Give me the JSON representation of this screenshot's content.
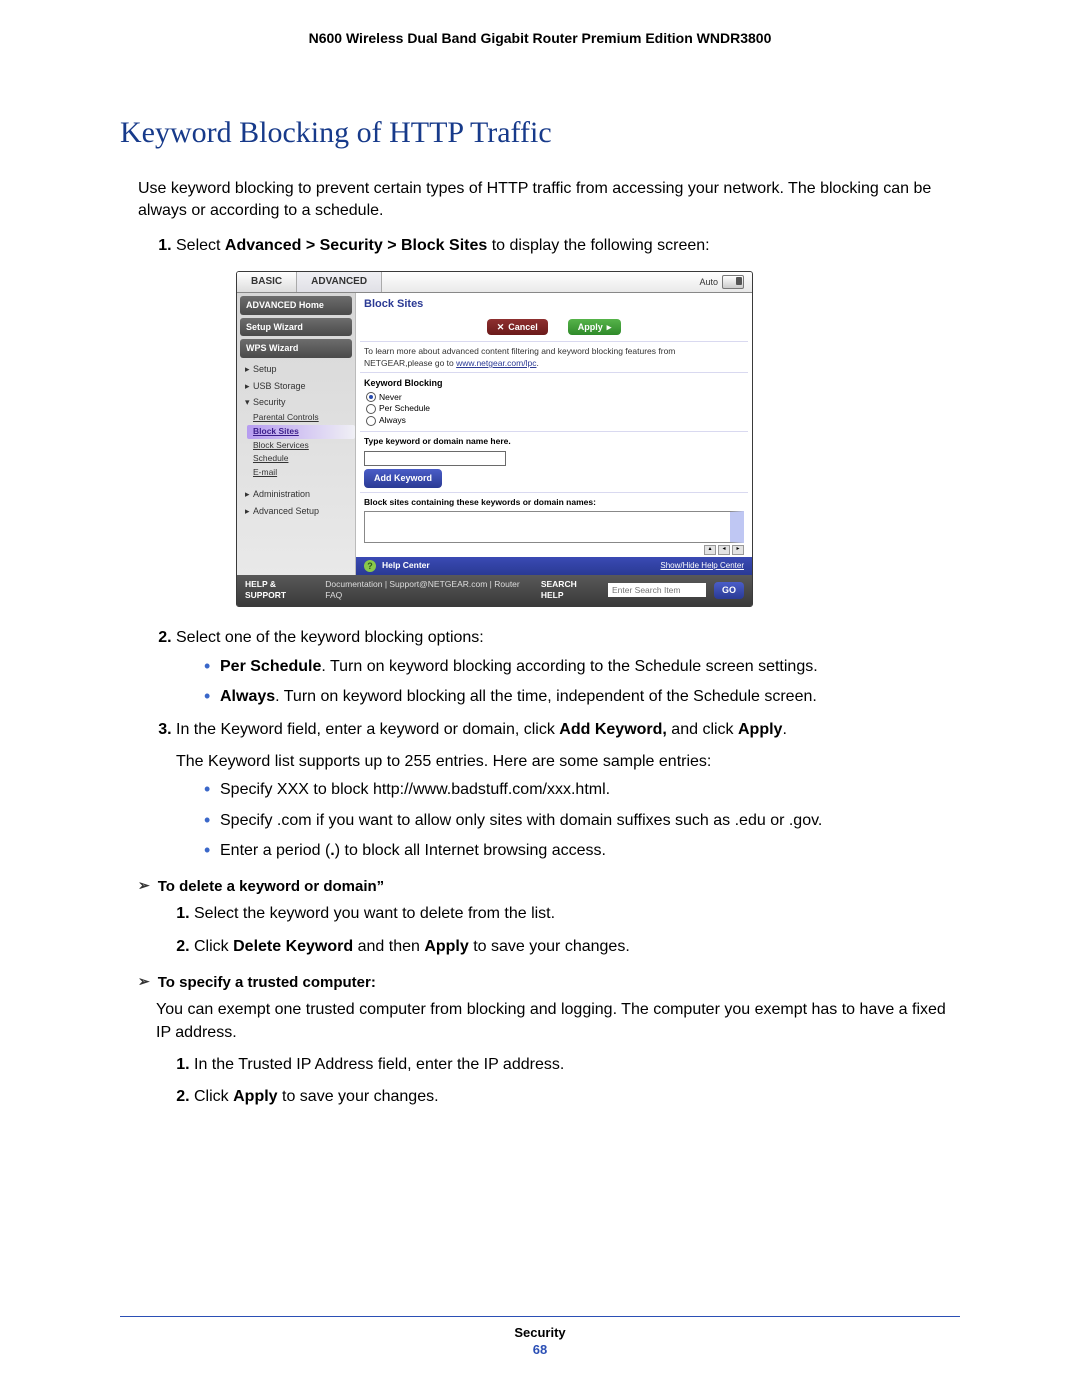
{
  "doc_header": "N600 Wireless Dual Band Gigabit Router Premium Edition WNDR3800",
  "title": "Keyword Blocking of HTTP Traffic",
  "intro": "Use keyword blocking to prevent certain types of HTTP traffic from accessing your network. The blocking can be always or according to a schedule.",
  "steps": {
    "s1_pre": "Select ",
    "s1_bold": "Advanced > Security > Block Sites",
    "s1_post": " to display the following screen:",
    "s2": "Select one of the keyword blocking options:",
    "s2_b1_bold": "Per Schedule",
    "s2_b1_text": ". Turn on keyword blocking according to the Schedule screen settings.",
    "s2_b2_bold": "Always",
    "s2_b2_text": ". Turn on keyword blocking all the time, independent of the Schedule screen.",
    "s3_a": "In the Keyword field, enter a keyword or domain, click ",
    "s3_b": "Add Keyword,",
    "s3_c": " and click ",
    "s3_d": "Apply",
    "s3_e": ".",
    "s3_note": "The Keyword list supports up to 255 entries. Here are some sample entries:",
    "s3_l1": "Specify XXX to block http://www.badstuff.com/xxx.html.",
    "s3_l2": "Specify .com if you want to allow only sites with domain suffixes such as .edu or .gov.",
    "s3_l3a": "Enter a period (",
    "s3_l3b": ".",
    "s3_l3c": ") to block all Internet browsing access."
  },
  "subA": {
    "heading": "To delete a keyword or domain”",
    "l1": "Select the keyword you want to delete from the list.",
    "l2a": "Click ",
    "l2b": "Delete Keyword",
    "l2c": " and then ",
    "l2d": "Apply",
    "l2e": " to save your changes."
  },
  "subB": {
    "heading": "To specify a trusted computer:",
    "intro": "You can exempt one trusted computer from blocking and logging. The computer you exempt has to have a fixed IP address.",
    "l1": "In the Trusted IP Address field, enter the IP address.",
    "l2a": "Click ",
    "l2b": "Apply",
    "l2c": " to save your changes."
  },
  "screenshot": {
    "tabs": {
      "basic": "BASIC",
      "advanced": "ADVANCED",
      "auto": "Auto"
    },
    "sidebar": {
      "home": "ADVANCED Home",
      "setup_wizard": "Setup Wizard",
      "wps_wizard": "WPS Wizard",
      "setup": "Setup",
      "usb": "USB Storage",
      "security": "Security",
      "sec_items": [
        "Parental Controls",
        "Block Sites",
        "Block Services",
        "Schedule",
        "E-mail"
      ],
      "admin": "Administration",
      "adv_setup": "Advanced Setup"
    },
    "main": {
      "title": "Block Sites",
      "cancel": "Cancel",
      "apply": "Apply",
      "info_a": "To learn more about advanced content filtering and keyword blocking features from NETGEAR,please go to ",
      "info_link": "www.netgear.com/lpc",
      "kw_head": "Keyword Blocking",
      "opts": [
        "Never",
        "Per Schedule",
        "Always"
      ],
      "type_label": "Type keyword or domain name here.",
      "add_kw": "Add Keyword",
      "block_head": "Block sites containing these keywords or domain names:"
    },
    "help": {
      "label": "Help Center",
      "show": "Show/Hide Help Center"
    },
    "footer": {
      "support": "HELP & SUPPORT",
      "links": "Documentation | Support@NETGEAR.com | Router FAQ",
      "search_lbl": "SEARCH HELP",
      "placeholder": "Enter Search Item",
      "go": "GO"
    }
  },
  "footer": {
    "section": "Security",
    "page": "68"
  }
}
